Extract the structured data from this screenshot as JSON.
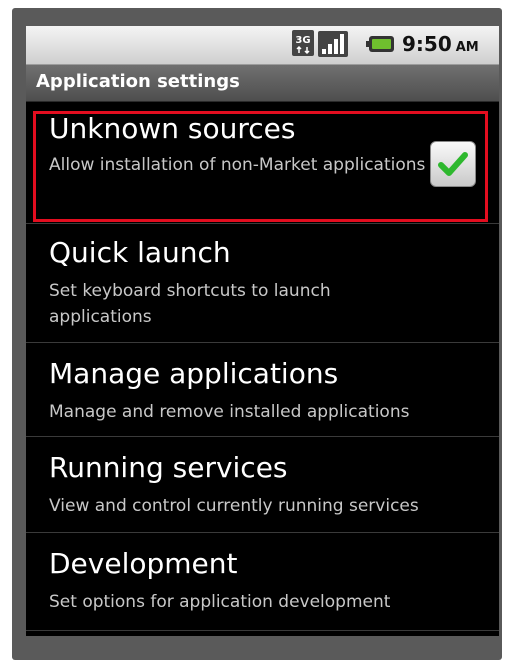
{
  "status_bar": {
    "network": "3G",
    "time": "9:50",
    "ampm": "AM",
    "icons": [
      "3g-network-icon",
      "signal-icon",
      "battery-icon"
    ]
  },
  "header": {
    "title": "Application settings"
  },
  "settings": [
    {
      "title": "Unknown sources",
      "summary": "Allow installation of non-Market applications",
      "checked": true
    },
    {
      "title": "Quick launch",
      "summary": "Set keyboard shortcuts to launch applications"
    },
    {
      "title": "Manage applications",
      "summary": "Manage and remove installed applications"
    },
    {
      "title": "Running services",
      "summary": "View and control currently running services"
    },
    {
      "title": "Development",
      "summary": "Set options for application development"
    }
  ],
  "colors": {
    "highlight": "#e30d1f",
    "check": "#2eb82e",
    "background": "#000000"
  }
}
